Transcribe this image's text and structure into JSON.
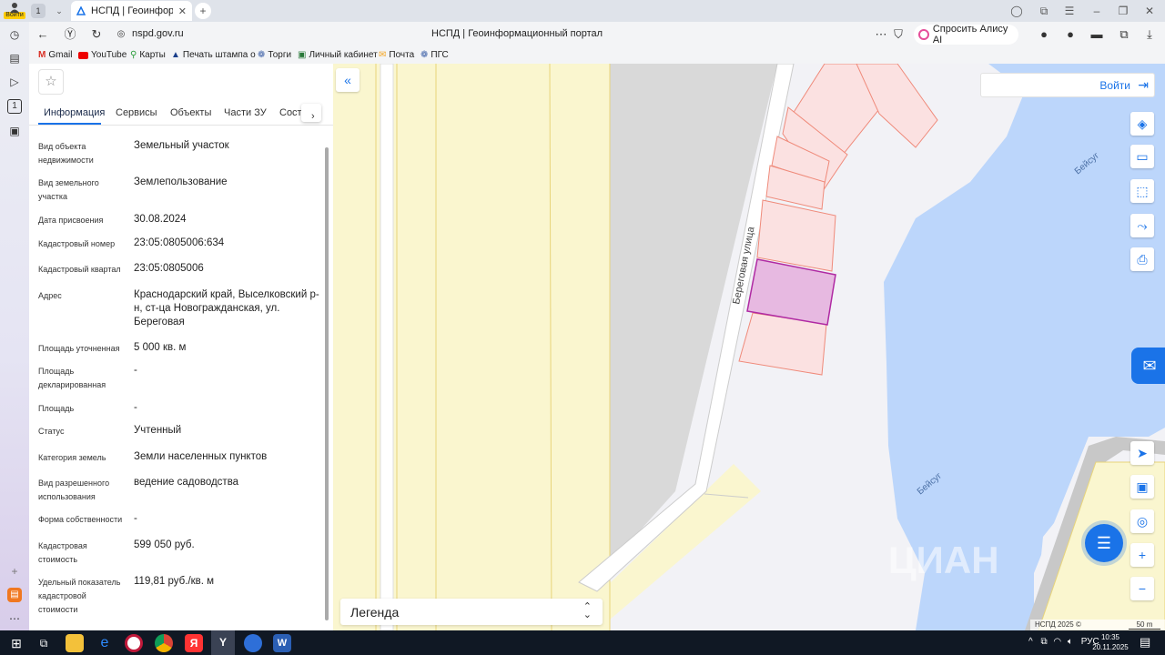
{
  "browser": {
    "profile_label": "Войти",
    "tab_count": "1",
    "tab_title": "НСПД | Геоинформаци",
    "url": "nspd.gov.ru",
    "page_title": "НСПД | Геоинформационный портал",
    "alisa_label": "Спросить Алису AI",
    "bookmarks": [
      "Gmail",
      "YouTube",
      "Карты",
      "Печать штампа о",
      "Торги",
      "Личный кабинет",
      "Почта",
      "ПГС"
    ]
  },
  "panel": {
    "tabs": [
      "Информация",
      "Сервисы",
      "Объекты",
      "Части ЗУ",
      "Соста"
    ],
    "fields": [
      {
        "label": "Вид объекта недвижимости",
        "value": "Земельный участок"
      },
      {
        "label": "Вид земельного участка",
        "value": "Землепользование"
      },
      {
        "label": "Дата присвоения",
        "value": "30.08.2024"
      },
      {
        "label": "Кадастровый номер",
        "value": "23:05:0805006:634"
      },
      {
        "label": "Кадастровый квартал",
        "value": "23:05:0805006"
      },
      {
        "label": "Адрес",
        "value": "Краснодарский край, Выселковский р-н, ст-ца Новогражданская, ул. Береговая"
      },
      {
        "label": "Площадь уточненная",
        "value": "5 000 кв. м"
      },
      {
        "label": "Площадь декларированная",
        "value": "-"
      },
      {
        "label": "Площадь",
        "value": "-"
      },
      {
        "label": "Статус",
        "value": "Учтенный"
      },
      {
        "label": "Категория земель",
        "value": "Земли населенных пунктов"
      },
      {
        "label": "Вид разрешенного использования",
        "value": "ведение садоводства"
      },
      {
        "label": "Форма собственности",
        "value": "-"
      },
      {
        "label": "Кадастровая стоимость",
        "value": "599 050 руб."
      },
      {
        "label": "Удельный показатель кадастровой стоимости",
        "value": "119,81 руб./кв. м"
      }
    ]
  },
  "map": {
    "login_label": "Войти",
    "street_label": "Береговая улица",
    "river_label_1": "Бейсуг",
    "river_label_2": "Бейсуг",
    "legend_label": "Легенда",
    "copyright": "НСПД 2025 ©",
    "scale_label": "50 m",
    "watermark": "ЦИАН"
  },
  "taskbar": {
    "time": "10:35",
    "date": "20.11.2025",
    "lang": "РУС"
  },
  "colors": {
    "water": "#bcd6fb",
    "parcel_fill": "#fbe1e1",
    "parcel_stroke": "#ef8a7a",
    "selected_fill": "#e7b9e1",
    "selected_stroke": "#b02aa3",
    "field": "#faf6cf",
    "accent": "#1a73e8"
  }
}
